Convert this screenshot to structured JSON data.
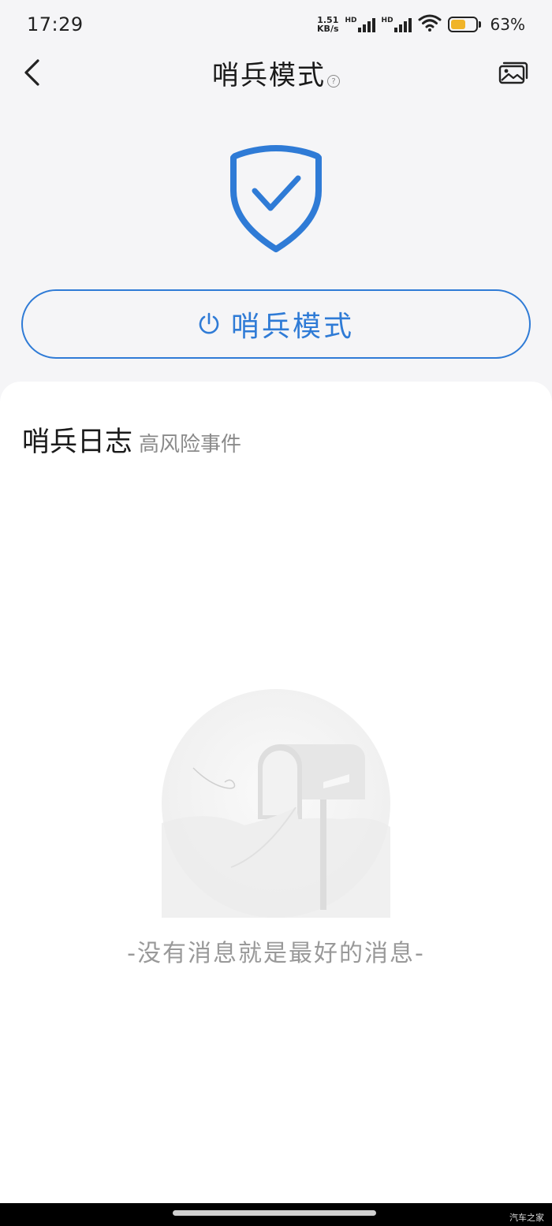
{
  "status_bar": {
    "time": "17:29",
    "net_speed_value": "1.51",
    "net_speed_unit": "KB/s",
    "sim1_label": "HD",
    "sim2_label": "HD",
    "battery_level": 0.63,
    "battery_text": "63%",
    "battery_color": "#f0b429"
  },
  "nav": {
    "title": "哨兵模式",
    "back_icon": "chevron-left-icon",
    "help_icon": "question-circle-icon",
    "help_glyph": "?",
    "album_icon": "gallery-icon"
  },
  "hero": {
    "icon": "shield-check-icon",
    "accent_color": "#2f7bd6"
  },
  "toggle_button": {
    "icon": "power-icon",
    "label": "哨兵模式"
  },
  "log": {
    "title": "哨兵日志",
    "subtitle": "高风险事件",
    "empty_icon": "mailbox-icon",
    "empty_text": "-没有消息就是最好的消息-"
  },
  "watermark": "汽车之家"
}
